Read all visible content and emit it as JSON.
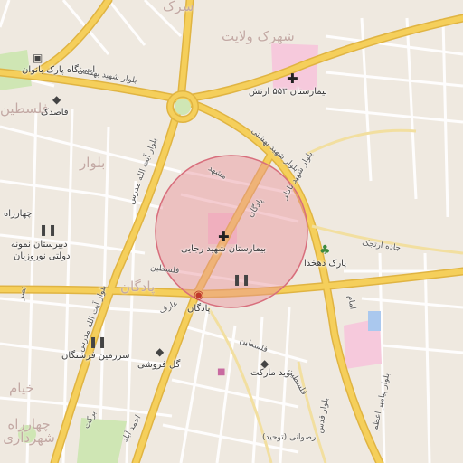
{
  "map": {
    "colors": {
      "land": "#efe9e0",
      "block": "#e6e1da",
      "street_line": "#ffffff",
      "major_road": "#f5cf5b",
      "major_road_edge": "#e0b442",
      "hospital_fill": "#f6c9dc",
      "park_fill": "#cfe6b4",
      "circle_fill": "#e8909a",
      "circle_stroke": "#d86e7c",
      "metro_icon": "#c0392b"
    },
    "area_labels": {
      "shahrak_velayat": "شهرک ولایت",
      "bolvar": "بلوار",
      "padegan_west": "پادگان",
      "falestin_top": "فلسطین",
      "khiyam": "خیام",
      "chaharrah_shahrdari": "چهارراه شهرداری",
      "sarak_top": "سرک"
    },
    "poi_labels": {
      "bus_station": "ایستگاه پارک بانوان",
      "ghasedak": "قاصدک",
      "hospital_553": "بیمارستان ۵۵۳ ارتش",
      "rajaei_hospital": "بیمارستان شهید رجایی",
      "park_dehkhoda": "پارک دهخدا",
      "chaharrah": "چهارراه",
      "dabirestan_line1": "دبیرستان نمونه",
      "dabirestan_line2": "دولتی نوروزیان",
      "padegan_station": "پادگان",
      "sarzamin": "سرزمین فرشتگان",
      "gol_foroushi": "گل فروشی",
      "navid_market": "نوید مارکت",
      "jade_arjang": "جاده ارتجک"
    },
    "street_labels": {
      "shahid_beheshti_west": "بلوار شهید بهشتی",
      "shahid_beheshti_east": "بلوار شهید بهشتی",
      "ayatollah_modarres": "بلوار آیت الله مدرس",
      "ayatollah_modarres_2": "بلوار آیت الله مدرس",
      "mashhad": "مشهد",
      "padegan_st": "پادگان",
      "falestin": "فلسطین",
      "falestin_2": "فلسطین",
      "falestin_3": "فلسطین",
      "aref": "عارف",
      "shahid_nazer": "بلوار شهید ناظر",
      "ghods": "بلوار قدس",
      "baraka": "برکت",
      "tohid": "رضوانی (توحید)",
      "imam": "امام",
      "ahmad_abad": "احمد آباد",
      "nasr": "نصر",
      "bolvar_azimi": "بلوار پیامبر اعظم"
    },
    "icons": {
      "bus": "bus-icon",
      "shopping": "shopping-bag-icon",
      "hospital": "hospital-cross-icon",
      "park": "tree-icon",
      "school": "school-icon",
      "metro": "metro-icon",
      "parking": "parking-icon"
    }
  }
}
